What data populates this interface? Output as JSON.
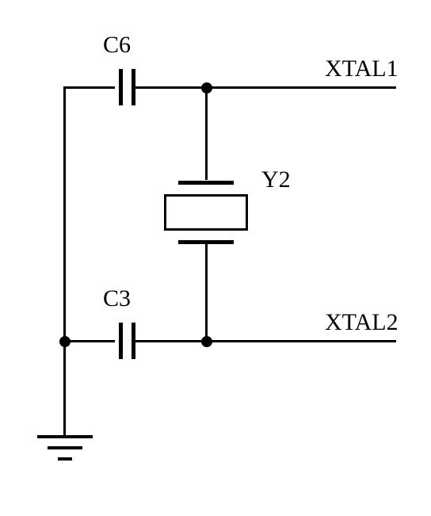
{
  "labels": {
    "c6": "C6",
    "c3": "C3",
    "y2": "Y2",
    "xtal1": "XTAL1",
    "xtal2": "XTAL2"
  },
  "components": {
    "C6": {
      "type": "capacitor"
    },
    "C3": {
      "type": "capacitor"
    },
    "Y2": {
      "type": "crystal"
    }
  },
  "nets": {
    "XTAL1": [
      "C6.2",
      "Y2.1"
    ],
    "XTAL2": [
      "C3.2",
      "Y2.2"
    ],
    "GND": [
      "C6.1",
      "C3.1"
    ]
  }
}
